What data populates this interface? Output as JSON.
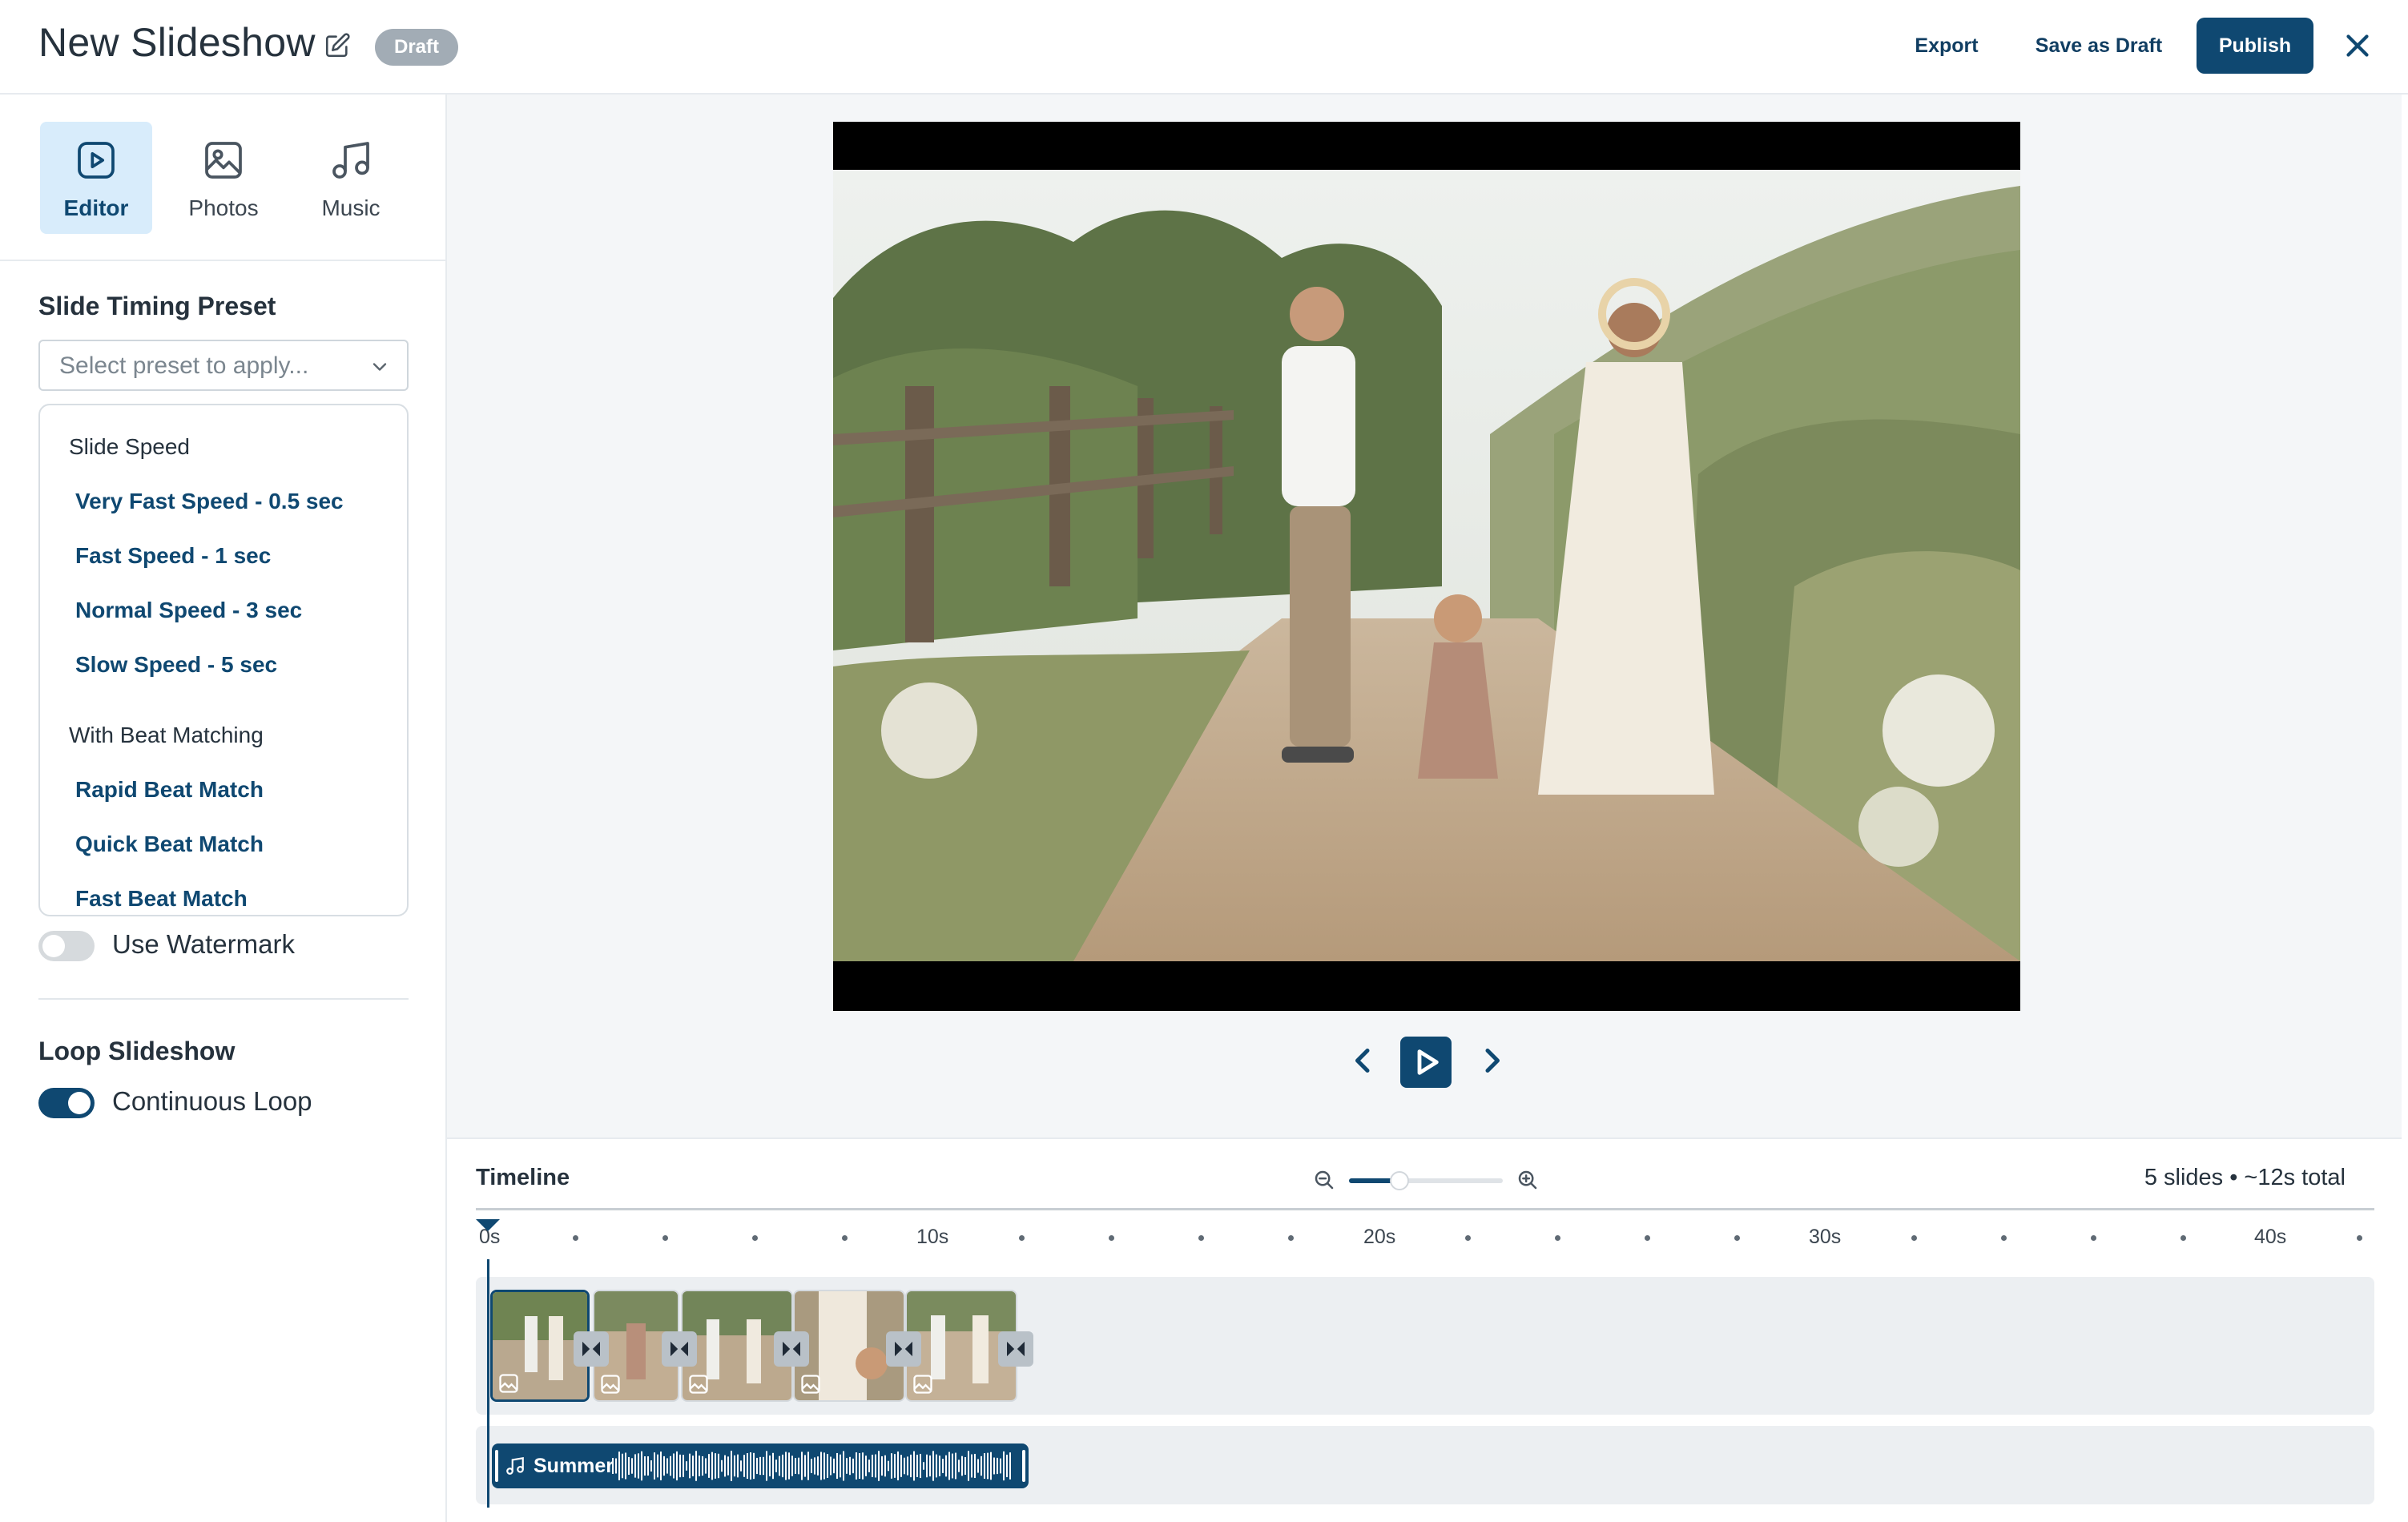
{
  "header": {
    "title": "New Slideshow",
    "status_badge": "Draft",
    "export_label": "Export",
    "save_draft_label": "Save as Draft",
    "publish_label": "Publish"
  },
  "sidebar": {
    "tabs": [
      {
        "label": "Editor",
        "icon": "play-square-icon",
        "active": true
      },
      {
        "label": "Photos",
        "icon": "image-icon",
        "active": false
      },
      {
        "label": "Music",
        "icon": "music-note-icon",
        "active": false
      }
    ],
    "timing_preset": {
      "title": "Slide Timing Preset",
      "placeholder": "Select preset to apply...",
      "groups": [
        {
          "label": "Slide Speed",
          "options": [
            "Very Fast Speed - 0.5 sec",
            "Fast Speed - 1 sec",
            "Normal Speed - 3 sec",
            "Slow Speed - 5 sec"
          ]
        },
        {
          "label": "With Beat Matching",
          "options": [
            "Rapid Beat Match",
            "Quick Beat Match",
            "Fast Beat Match"
          ]
        }
      ]
    },
    "watermark": {
      "label": "Use Watermark",
      "on": false
    },
    "loop": {
      "title": "Loop Slideshow",
      "label": "Continuous Loop",
      "on": true
    }
  },
  "timeline": {
    "title": "Timeline",
    "summary": "5 slides • ~12s total",
    "zoom_level": 0.33,
    "ticks": [
      "0s",
      "10s",
      "20s",
      "30s",
      "40s"
    ],
    "slides": 5,
    "audio_track": {
      "name": "Summer"
    }
  },
  "colors": {
    "accent": "#0f4871",
    "active_tab_bg": "#d8ecfb",
    "badge": "#a2acb5"
  }
}
